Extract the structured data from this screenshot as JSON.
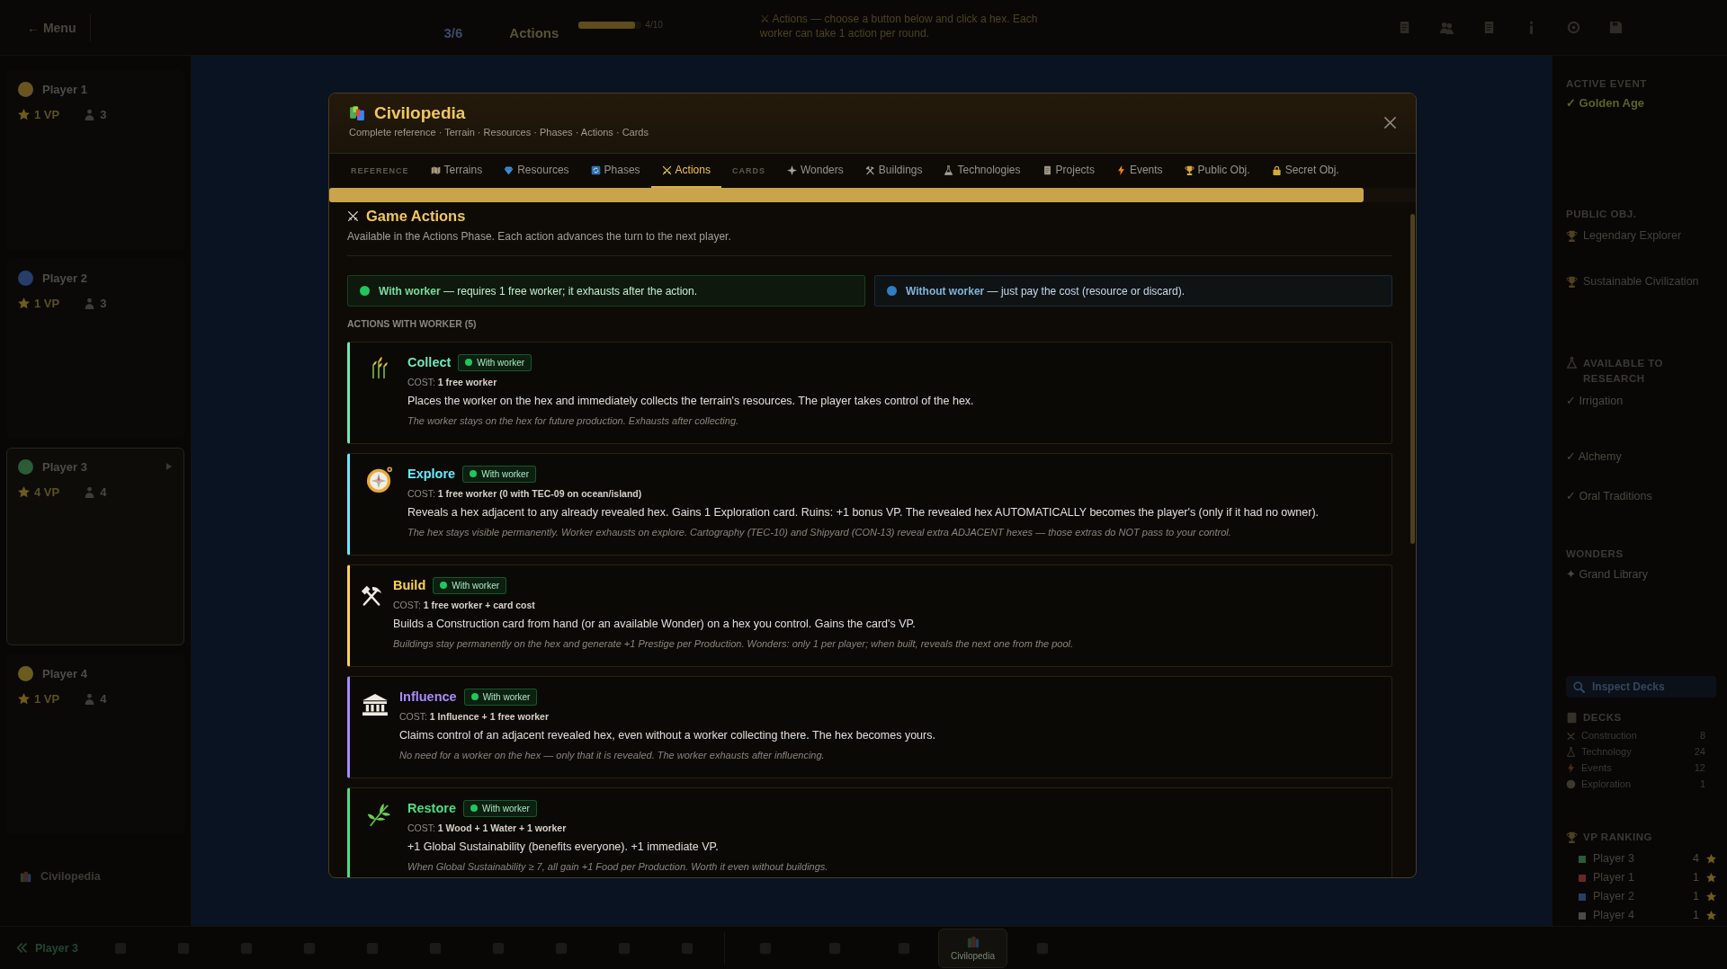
{
  "top_bar": {
    "menu_button": "← Menu",
    "round": "3/6",
    "phase": "Actions",
    "progress": {
      "level": 0.9,
      "label": "4/10"
    },
    "hint": "⚔ Actions — choose a button below and click a hex. Each worker can take 1 action per round."
  },
  "players": [
    {
      "name": "Player 1",
      "vp": "1 VP",
      "workers": "3",
      "color": "#6b5420",
      "selected": false
    },
    {
      "name": "Player 2",
      "vp": "1 VP",
      "workers": "3",
      "color": "#253f6a",
      "selected": false
    },
    {
      "name": "Player 3",
      "vp": "4 VP",
      "workers": "4",
      "color": "#2a5c35",
      "selected": true
    },
    {
      "name": "Player 4",
      "vp": "1 VP",
      "workers": "4",
      "color": "#6a5c1c",
      "selected": false
    }
  ],
  "sidebar_link": "Civilopedia",
  "right_panel": {
    "active_event": {
      "heading": "ACTIVE EVENT",
      "title": "✓ Golden Age"
    },
    "public_objectives": {
      "heading": "PUBLIC OBJ.",
      "items": [
        "Legendary Explorer",
        "Sustainable Civilization"
      ]
    },
    "research": {
      "heading": "AVAILABLE TO RESEARCH",
      "items": [
        "✓ Irrigation",
        "✓ Alchemy",
        "✓ Oral Traditions"
      ]
    },
    "wonders": {
      "heading": "WONDERS",
      "items": [
        "✦ Grand Library"
      ]
    },
    "inspect_button": "Inspect Decks",
    "decks": {
      "heading": "DECKS",
      "rows": [
        {
          "name": "Construction",
          "count": "8"
        },
        {
          "name": "Technology",
          "count": "24"
        },
        {
          "name": "Events",
          "count": "12"
        },
        {
          "name": "Exploration",
          "count": "1"
        }
      ]
    },
    "vp_ranking": {
      "heading": "VP RANKING",
      "rows": [
        {
          "name": "Player 3",
          "vp": "4",
          "color": "#2a5c35"
        },
        {
          "name": "Player 1",
          "vp": "1",
          "color": "#6a2626"
        },
        {
          "name": "Player 2",
          "vp": "1",
          "color": "#253f6a"
        },
        {
          "name": "Player 4",
          "vp": "1",
          "color": "#4a4a46"
        }
      ]
    }
  },
  "bottom_bar": {
    "player": "Player 3",
    "groups": [
      {
        "items": [
          {
            "selected": false
          },
          {
            "selected": false
          },
          {
            "selected": false
          },
          {
            "selected": false
          },
          {
            "selected": false
          },
          {
            "selected": false
          },
          {
            "selected": false
          },
          {
            "selected": false
          },
          {
            "selected": false
          },
          {
            "selected": false
          }
        ]
      },
      {
        "items": [
          {
            "selected": false
          },
          {
            "selected": false
          },
          {
            "selected": false
          },
          {
            "label": "Civilopedia",
            "selected": true
          },
          {
            "selected": false
          }
        ]
      }
    ]
  },
  "modal": {
    "title": "Civilopedia",
    "subtitle": "Complete reference · Terrain · Resources · Phases · Actions · Cards",
    "tab_groups": [
      {
        "label": "REFERENCE",
        "tabs": [
          {
            "label": "Terrains",
            "selected": false
          },
          {
            "label": "Resources",
            "selected": false
          },
          {
            "label": "Phases",
            "selected": false
          },
          {
            "label": "Actions",
            "selected": true
          }
        ]
      },
      {
        "label": "CARDS",
        "tabs": [
          {
            "label": "Wonders",
            "selected": false
          },
          {
            "label": "Buildings",
            "selected": false
          },
          {
            "label": "Technologies",
            "selected": false
          },
          {
            "label": "Projects",
            "selected": false
          },
          {
            "label": "Events",
            "selected": false
          },
          {
            "label": "Public Obj.",
            "selected": false
          },
          {
            "label": "Secret Obj.",
            "selected": false
          }
        ]
      }
    ],
    "section": {
      "title": "Game Actions",
      "description": "Available in the Actions Phase. Each action advances the turn to the next player.",
      "legend": [
        {
          "term": "With worker",
          "text": "— requires 1 free worker; it exhausts after the action.",
          "color": "#22c55e"
        },
        {
          "term": "Without worker",
          "text": "— just pay the cost (resource or discard).",
          "color": "#2f7fc1"
        }
      ],
      "group_label": "ACTIONS WITH WORKER (5)",
      "actions": [
        {
          "name": "Collect",
          "color": "#6ee7b7",
          "badge": {
            "label": "With worker",
            "color": "#22c55e"
          },
          "cost": "COST: **1 free worker**",
          "description": "Places the worker on the hex and immediately collects the terrain's resources. The player takes control of the hex.",
          "note": "The worker stays on the hex for future production. Exhausts after collecting."
        },
        {
          "name": "Explore",
          "color": "#67e8f9",
          "badge": {
            "label": "With worker",
            "color": "#22c55e"
          },
          "cost": "COST: **1 free worker (0 with TEC-09 on ocean/island)**",
          "description": "Reveals a hex adjacent to any already revealed hex. Gains 1 Exploration card. Ruins: +1 bonus VP. The revealed hex AUTOMATICALLY becomes the player's (only if it had no owner).",
          "note": "The hex stays visible permanently. Worker exhausts on explore. Cartography (TEC-10) and Shipyard (CON-13) reveal extra ADJACENT hexes — those extras do NOT pass to your control."
        },
        {
          "name": "Build",
          "color": "#fcd34d",
          "badge": {
            "label": "With worker",
            "color": "#22c55e"
          },
          "cost": "COST: **1 free worker + card cost**",
          "description": "Builds a Construction card from hand (or an available Wonder) on a hex you control. Gains the card's VP.",
          "note": "Buildings stay permanently on the hex and generate +1 Prestige per Production. Wonders: only 1 per player; when built, reveals the next one from the pool."
        },
        {
          "name": "Influence",
          "color": "#a78bfa",
          "badge": {
            "label": "With worker",
            "color": "#22c55e"
          },
          "cost": "COST: **1 Influence + 1 free worker**",
          "description": "Claims control of an adjacent revealed hex, even without a worker collecting there. The hex becomes yours.",
          "note": "No need for a worker on the hex — only that it is revealed. The worker exhausts after influencing."
        },
        {
          "name": "Restore",
          "color": "#4ade80",
          "badge": {
            "label": "With worker",
            "color": "#22c55e"
          },
          "cost": "COST: **1 Wood + 1 Water + 1 worker**",
          "description": "+1 Global Sustainability (benefits everyone). +1 immediate VP.",
          "note": "When Global Sustainability ≥ 7, all gain +1 Food per Production. Worth it even without buildings."
        }
      ]
    }
  }
}
